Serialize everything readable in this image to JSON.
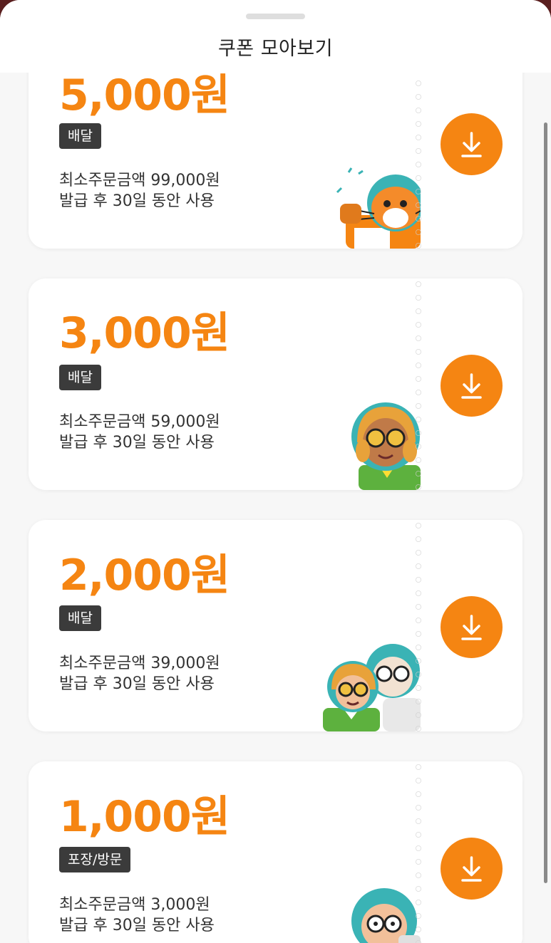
{
  "sheet": {
    "title": "쿠폰 모아보기"
  },
  "coupons": [
    {
      "amount": "5,000원",
      "badge": "배달",
      "min_order": "최소주문금액 99,000원",
      "validity": "발급 후 30일 동안 사용",
      "character": "cat-character-icon"
    },
    {
      "amount": "3,000원",
      "badge": "배달",
      "min_order": "최소주문금액 59,000원",
      "validity": "발급 후 30일 동안 사용",
      "character": "girl-character-icon"
    },
    {
      "amount": "2,000원",
      "badge": "배달",
      "min_order": "최소주문금액 39,000원",
      "validity": "발급 후 30일 동안 사용",
      "character": "two-characters-icon"
    },
    {
      "amount": "1,000원",
      "badge": "포장/방문",
      "min_order": "최소주문금액 3,000원",
      "validity": "발급 후 30일 동안 사용",
      "character": "grandpa-character-icon"
    }
  ],
  "colors": {
    "accent": "#f58512",
    "badge_bg": "#3b3b3b",
    "text": "#333333"
  },
  "icons": {
    "download": "download-icon"
  }
}
